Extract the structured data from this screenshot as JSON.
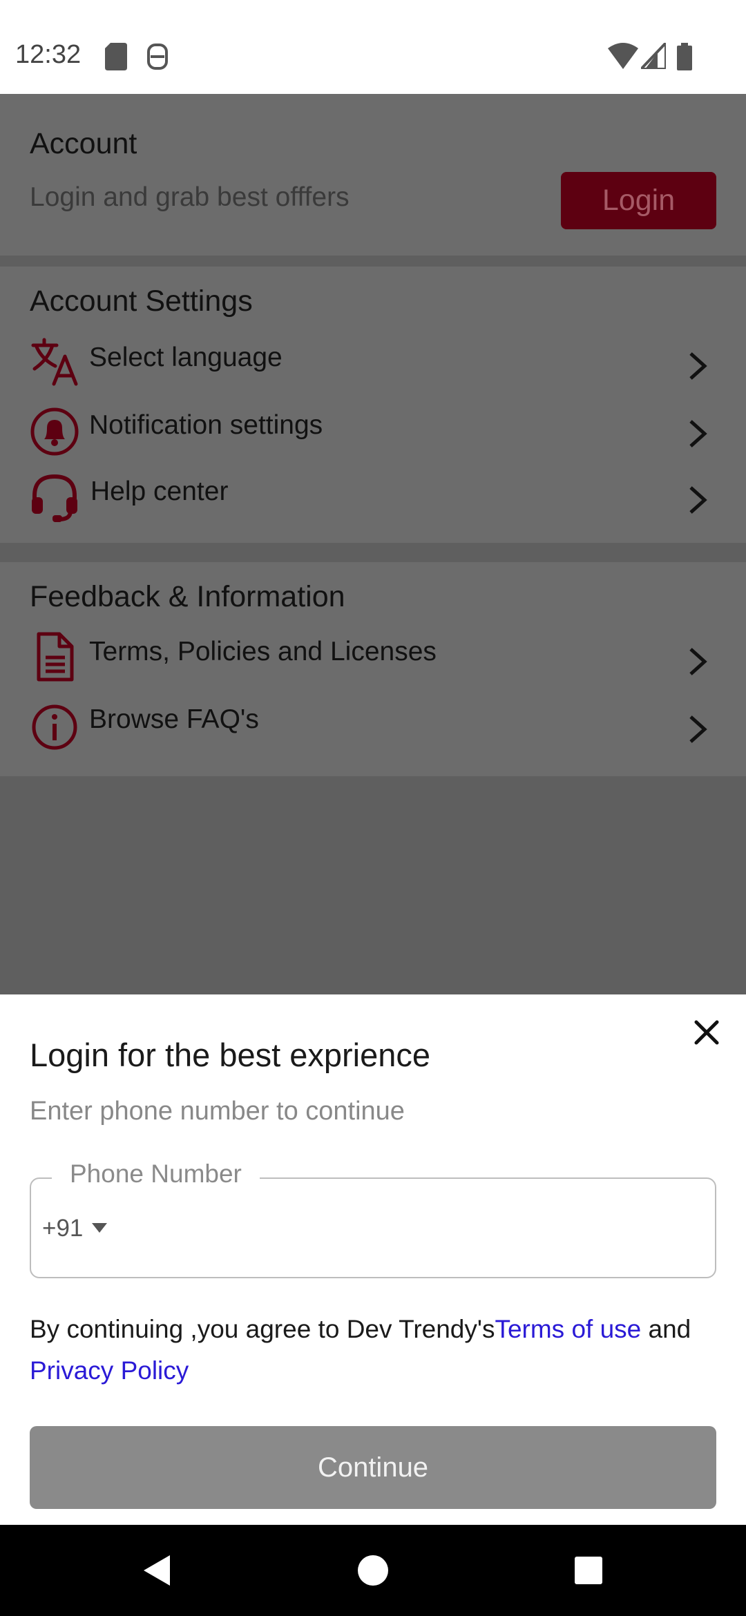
{
  "status_bar": {
    "time": "12:32",
    "icons": [
      "sd-card-icon",
      "notification-app-icon",
      "wifi-icon",
      "cellular-signal-icon",
      "battery-icon"
    ]
  },
  "account": {
    "title": "Account",
    "subtitle": "Login and grab best offfers",
    "login_label": "Login"
  },
  "account_settings": {
    "title": "Account Settings",
    "items": [
      {
        "label": "Select language",
        "icon": "translate-icon"
      },
      {
        "label": "Notification settings",
        "icon": "bell-icon"
      },
      {
        "label": "Help center",
        "icon": "headset-icon"
      }
    ]
  },
  "feedback": {
    "title": "Feedback & Information",
    "items": [
      {
        "label": "Terms, Policies and Licenses",
        "icon": "document-icon"
      },
      {
        "label": "Browse FAQ's",
        "icon": "info-icon"
      }
    ]
  },
  "login_sheet": {
    "title": "Login for the best exprience",
    "subtitle": "Enter phone number to continue",
    "phone_label": "Phone Number",
    "country_code": "+91",
    "terms_prefix": "By continuing ,you agree to Dev Trendy's",
    "terms_link": "Terms of use",
    "terms_and": " and",
    "privacy_link": "Privacy Policy",
    "continue_label": "Continue"
  },
  "colors": {
    "accent": "#5d0011",
    "link": "#2a1ad6",
    "overlay": "#5f5f5f"
  }
}
